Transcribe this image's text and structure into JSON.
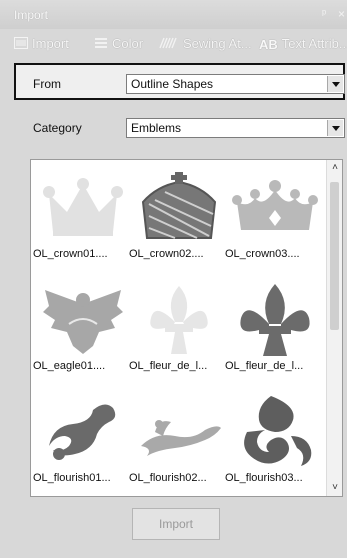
{
  "panel": {
    "title": "Import",
    "pin_glyph": "ᵖ",
    "close_glyph": "×"
  },
  "tabs": [
    {
      "label": "Import",
      "icon": "import-tab-icon",
      "active": true
    },
    {
      "label": "Color",
      "icon": "color-tab-icon",
      "active": false
    },
    {
      "label": "Sewing At...",
      "icon": "sewing-attributes-tab-icon",
      "active": false
    },
    {
      "label": "Text Attrib...",
      "icon": "text-attributes-tab-icon",
      "icon_text": "AB",
      "active": false
    }
  ],
  "from": {
    "label": "From",
    "value": "Outline Shapes"
  },
  "category": {
    "label": "Category",
    "value": "Emblems"
  },
  "gallery": {
    "items": [
      {
        "caption": "OL_crown01....",
        "shape": "crown-light"
      },
      {
        "caption": "OL_crown02....",
        "shape": "crown-ornate"
      },
      {
        "caption": "OL_crown03....",
        "shape": "crown-points"
      },
      {
        "caption": "OL_eagle01....",
        "shape": "eagle"
      },
      {
        "caption": "OL_fleur_de_l...",
        "shape": "fleur-light"
      },
      {
        "caption": "OL_fleur_de_l...",
        "shape": "fleur-dark"
      },
      {
        "caption": "OL_flourish01...",
        "shape": "flourish-1"
      },
      {
        "caption": "OL_flourish02...",
        "shape": "flourish-2"
      },
      {
        "caption": "OL_flourish03...",
        "shape": "flourish-3"
      }
    ]
  },
  "import_button": {
    "label": "Import",
    "enabled": false
  },
  "colors": {
    "titlebar_text": "#fafafa",
    "gallery_bg": "#ffffff",
    "disabled_text": "#9a9a9a"
  }
}
